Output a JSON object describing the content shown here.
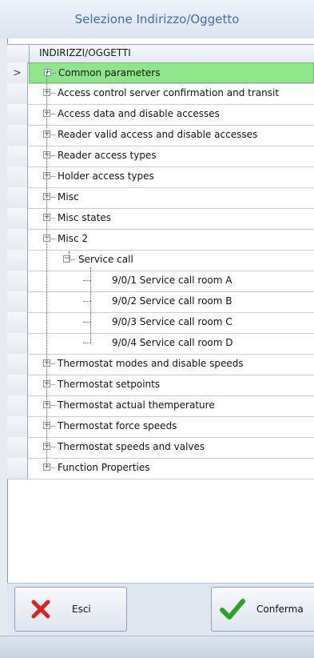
{
  "window": {
    "title": "Selezione Indirizzo/Oggetto"
  },
  "grid": {
    "column_header": "INDIRIZZI/OGGETTI",
    "current_row_marker": ">",
    "rows": [
      {
        "label": "Common parameters",
        "level": 0,
        "expander": "+",
        "selected": true,
        "current": true
      },
      {
        "label": "Access control server confirmation and transit",
        "level": 0,
        "expander": "+"
      },
      {
        "label": "Access data and disable accesses",
        "level": 0,
        "expander": "+"
      },
      {
        "label": "Reader valid access and disable accesses",
        "level": 0,
        "expander": "+"
      },
      {
        "label": "Reader access types",
        "level": 0,
        "expander": "+"
      },
      {
        "label": "Holder access types",
        "level": 0,
        "expander": "+"
      },
      {
        "label": "Misc",
        "level": 0,
        "expander": "+"
      },
      {
        "label": "Misc states",
        "level": 0,
        "expander": "+"
      },
      {
        "label": "Misc 2",
        "level": 0,
        "expander": "-"
      },
      {
        "label": "Service call",
        "level": 1,
        "expander": "-"
      },
      {
        "label": "9/0/1 Service call room A",
        "level": 2
      },
      {
        "label": "9/0/2 Service call room B",
        "level": 2
      },
      {
        "label": "9/0/3 Service call room C",
        "level": 2
      },
      {
        "label": "9/0/4 Service call room D",
        "level": 2
      },
      {
        "label": "Thermostat modes and disable speeds",
        "level": 0,
        "expander": "+"
      },
      {
        "label": "Thermostat setpoints",
        "level": 0,
        "expander": "+"
      },
      {
        "label": "Thermostat actual themperature",
        "level": 0,
        "expander": "+"
      },
      {
        "label": "Thermostat force speeds",
        "level": 0,
        "expander": "+"
      },
      {
        "label": "Thermostat speeds and valves",
        "level": 0,
        "expander": "+"
      },
      {
        "label": "Function Properties",
        "level": 0,
        "expander": "+"
      }
    ]
  },
  "footer": {
    "cancel": {
      "label": "Esci",
      "icon": "red-x-icon",
      "color": "#e02020"
    },
    "confirm": {
      "label": "Conferma",
      "icon": "green-check-icon",
      "color": "#2aa52a"
    }
  },
  "colors": {
    "selection": "#8ee58a",
    "title_text": "#3f6ea6"
  }
}
